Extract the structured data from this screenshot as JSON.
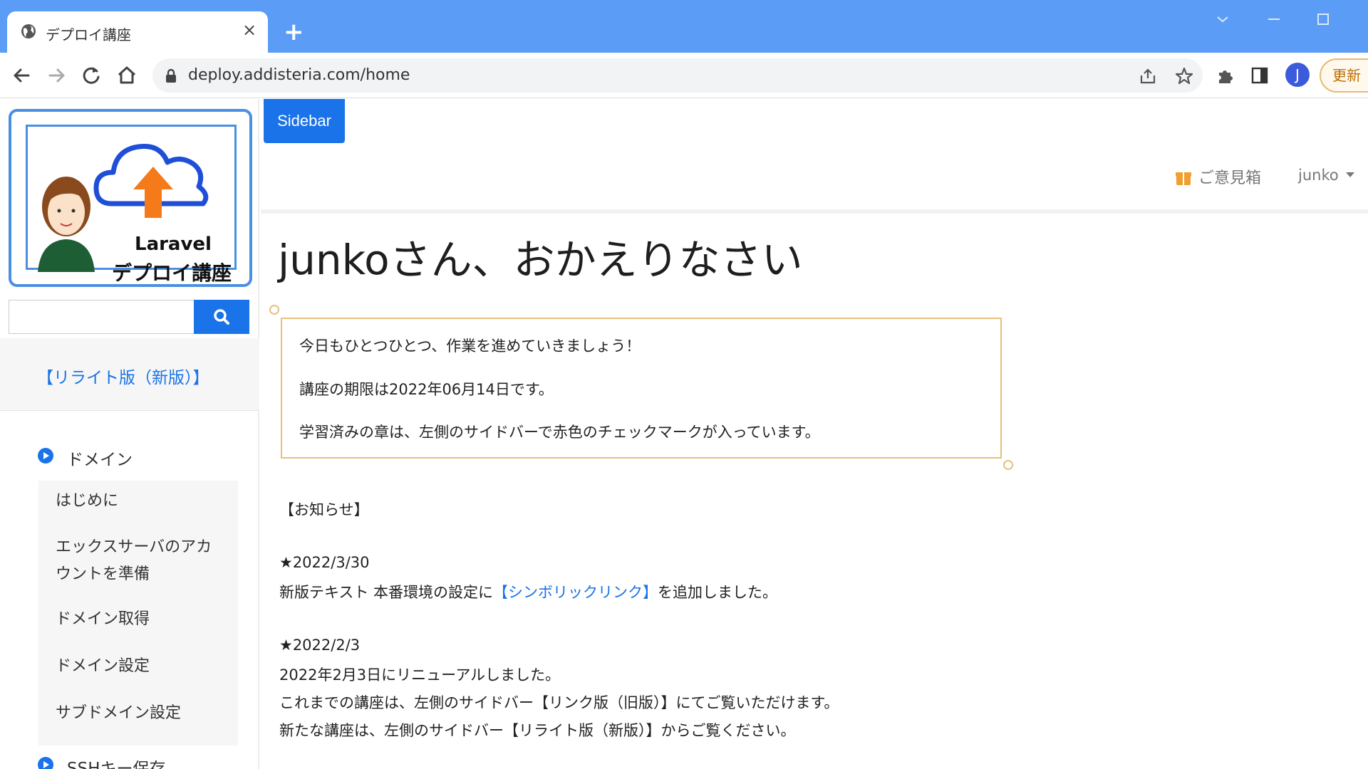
{
  "browser": {
    "tab_title": "デプロイ講座",
    "tab_close": "×",
    "new_tab": "+",
    "url": "deploy.addisteria.com/home",
    "profile_initial": "J",
    "update_label": "更新"
  },
  "sidebar": {
    "logo_text_line1": "Laravel",
    "logo_text_line2": "デプロイ講座",
    "search_placeholder": "",
    "rewrite_link": "【リライト版（新版）】",
    "sections": [
      {
        "label": "ドメイン",
        "items": [
          "はじめに",
          "エックスサーバのアカ",
          "ウントを準備",
          "ドメイン取得",
          "ドメイン設定",
          "サブドメイン設定"
        ]
      },
      {
        "label": "SSHキー保存"
      }
    ]
  },
  "header": {
    "sidebar_toggle": "Sidebar",
    "feedback": "ご意見箱",
    "username": "junko"
  },
  "main": {
    "welcome_title": "junkoさん、おかえりなさい",
    "messages": [
      "今日もひとつひとつ、作業を進めていきましょう！",
      "講座の期限は2022年06月14日です。",
      "学習済みの章は、左側のサイドバーで赤色のチェックマークが入っています。"
    ],
    "news_heading": "【お知らせ】",
    "news": [
      {
        "date": "★2022/3/30",
        "text_before": "新版テキスト 本番環境の設定に",
        "link": "【シンボリックリンク】",
        "text_after": "を追加しました。"
      },
      {
        "date": "★2022/2/3",
        "lines": [
          "2022年2月3日にリニューアルしました。",
          "これまでの講座は、左側のサイドバー【リンク版（旧版）】にてご覧いただけます。",
          "新たな講座は、左側のサイドバー【リライト版（新版）】からご覧ください。"
        ]
      }
    ]
  },
  "colors": {
    "browser_tabbar": "#5b9cf6",
    "accent_blue": "#1a73e8",
    "message_border": "#e8c07b",
    "feedback_icon": "#f0a030"
  }
}
